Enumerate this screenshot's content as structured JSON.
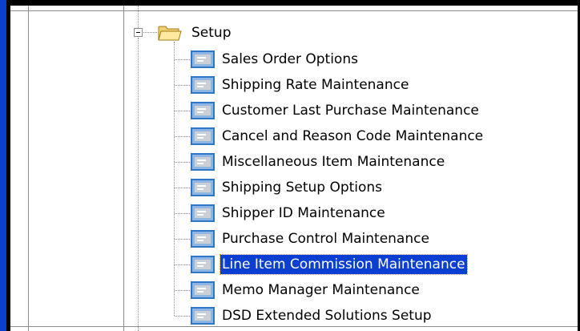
{
  "tree": {
    "folder": {
      "label": "Setup",
      "expanded": true
    },
    "items": [
      {
        "label": "Sales Order Options",
        "selected": false
      },
      {
        "label": "Shipping Rate Maintenance",
        "selected": false
      },
      {
        "label": "Customer Last Purchase Maintenance",
        "selected": false
      },
      {
        "label": "Cancel and Reason Code Maintenance",
        "selected": false
      },
      {
        "label": "Miscellaneous Item Maintenance",
        "selected": false
      },
      {
        "label": "Shipping Setup Options",
        "selected": false
      },
      {
        "label": "Shipper ID Maintenance",
        "selected": false
      },
      {
        "label": "Purchase Control Maintenance",
        "selected": false
      },
      {
        "label": "Line Item Commission Maintenance",
        "selected": true
      },
      {
        "label": "Memo Manager Maintenance",
        "selected": false
      },
      {
        "label": "DSD Extended Solutions Setup",
        "selected": false
      }
    ]
  },
  "colors": {
    "selection": "#0a3fd0",
    "window_border": "#0a3fd0"
  }
}
